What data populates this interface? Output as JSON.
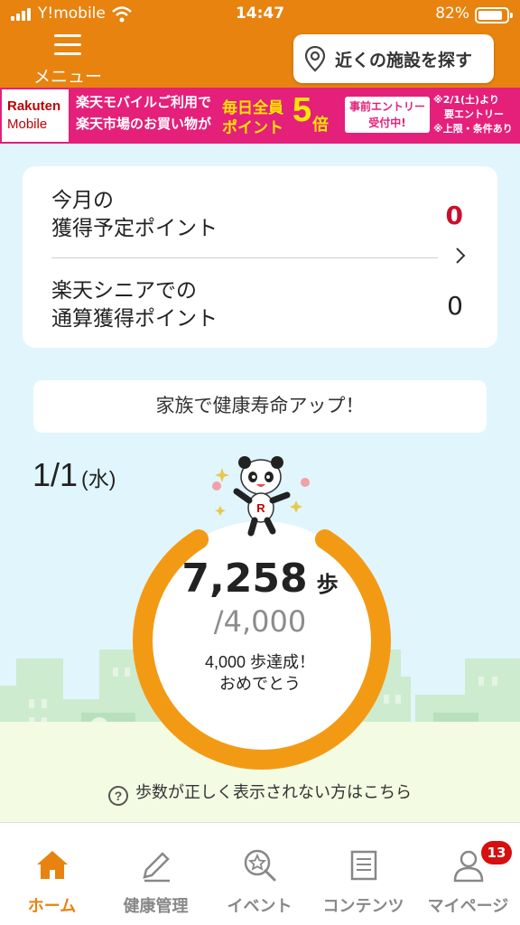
{
  "status_bar": {
    "carrier": "Y!mobile",
    "time": "14:47",
    "battery": "82%"
  },
  "header": {
    "menu_label": "メニュー",
    "facility_button": "近くの施設を探す"
  },
  "banner": {
    "logo_line1": "Rakuten",
    "logo_line2": "Mobile",
    "line1": "楽天モバイルご利用で",
    "line2": "楽天市場のお買い物が",
    "everyday": "毎日全員",
    "points": "ポイント",
    "big_number": "5",
    "times": "倍",
    "entry_line1": "事前エントリー",
    "entry_line2": "受付中!",
    "note_line1": "※2/1(土)より",
    "note_line2": "要エントリー",
    "note_line3": "※上限・条件あり"
  },
  "points_card": {
    "row1_label_line1": "今月の",
    "row1_label_line2": "獲得予定ポイント",
    "row1_value": "0",
    "row2_label_line1": "楽天シニアでの",
    "row2_label_line2": "通算獲得ポイント",
    "row2_value": "0"
  },
  "family_button": "家族で健康寿命アップ！",
  "steps": {
    "date": "1/1",
    "weekday": "(水)",
    "count": "7,258",
    "unit": "歩",
    "goal": "/4,000",
    "progress": 1.0,
    "message_line1": "4,000 歩達成！",
    "message_line2": "おめでとう"
  },
  "help_link": "歩数が正しく表示されない方はこちら",
  "colors": {
    "brand_orange": "#e8830f",
    "banner_pink": "#e4207a",
    "background_sky": "#e1f5fc",
    "points_red": "#c8102e",
    "badge_red": "#d70f0f"
  },
  "nav": {
    "items": [
      {
        "label": "ホーム",
        "icon": "home-icon",
        "active": true
      },
      {
        "label": "健康管理",
        "icon": "pencil-icon",
        "active": false
      },
      {
        "label": "イベント",
        "icon": "event-search-icon",
        "active": false
      },
      {
        "label": "コンテンツ",
        "icon": "document-icon",
        "active": false
      },
      {
        "label": "マイページ",
        "icon": "person-icon",
        "active": false
      }
    ],
    "badge_count": "13"
  }
}
